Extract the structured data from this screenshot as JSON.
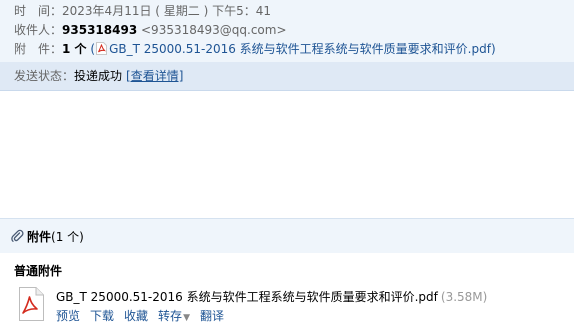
{
  "header": {
    "time_label": "时　间：",
    "time_value": "2023年4月11日 ( 星期二 ) 下午5：41",
    "recipient_label": "收件人：",
    "recipient_name": "935318493",
    "recipient_email": "<935318493@qq.com>",
    "attachment_label": "附　件：",
    "attachment_count": "1 个",
    "attachment_open_paren": "(",
    "attachment_file": "GB_T 25000.51-2016 系统与软件工程系统与软件质量要求和评价.pdf",
    "attachment_close_paren": ")"
  },
  "status": {
    "label": "发送状态：",
    "value": "投递成功",
    "detail_link": "[查看详情]"
  },
  "attachments": {
    "title": "附件",
    "count": "(1 个)",
    "section_title": "普通附件",
    "file": {
      "name": "GB_T 25000.51-2016 系统与软件工程系统与软件质量要求和评价.pdf",
      "size": "(3.58M)",
      "actions": {
        "preview": "预览",
        "download": "下载",
        "favorite": "收藏",
        "forward": "转存",
        "translate": "翻译"
      }
    }
  },
  "icons": {
    "pdf": "pdf-file-icon",
    "paperclip": "paperclip-icon",
    "dropdown": "caret-down-icon"
  },
  "colors": {
    "header_bg": "#eff5fb",
    "status_bg": "#dfe9f5",
    "link": "#1e5494",
    "pdf_red": "#d42b1e"
  }
}
